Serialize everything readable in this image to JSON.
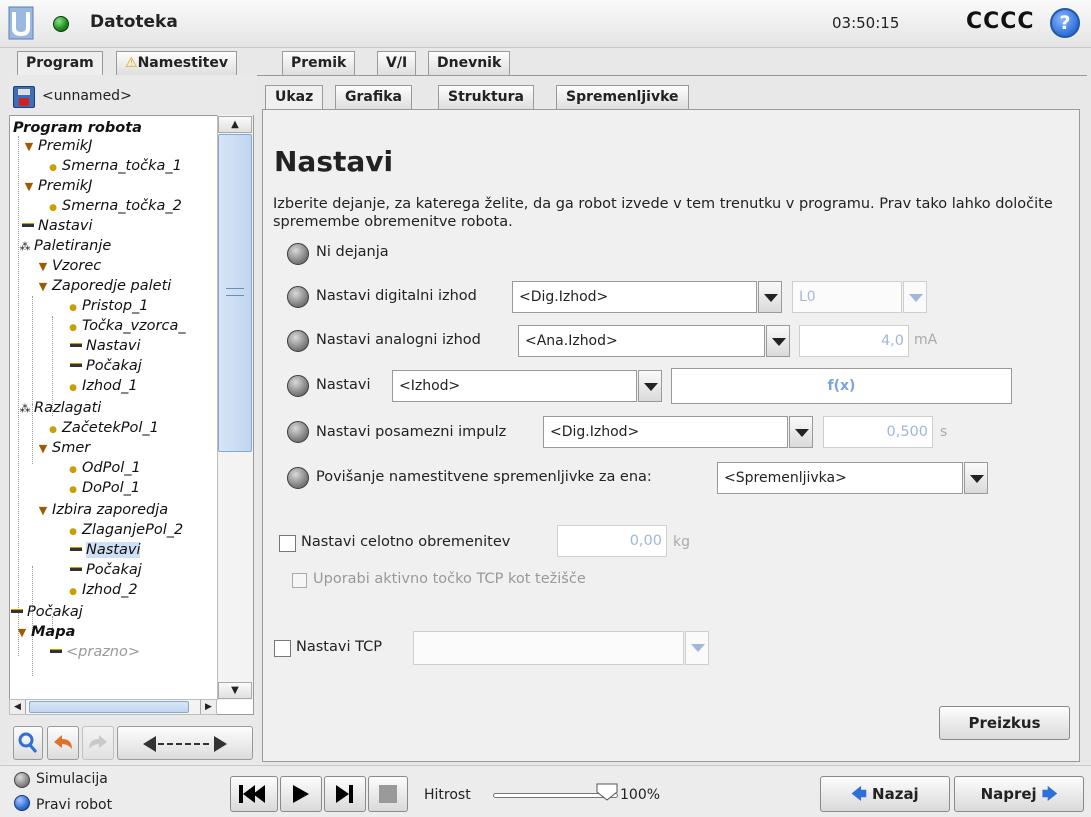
{
  "header": {
    "menu_label": "Datoteka",
    "clock": "03:50:15",
    "robot_name": "CCCC",
    "help": "?"
  },
  "main_tabs": [
    {
      "label": "Program",
      "active": true
    },
    {
      "label": "Namestitev",
      "warning": true
    },
    {
      "label": "Premik"
    },
    {
      "label": "V/I"
    },
    {
      "label": "Dnevnik"
    }
  ],
  "program": {
    "name": "<unnamed>",
    "tree": [
      {
        "label": "Program robota",
        "icon": "none",
        "bold": true
      },
      {
        "label": "PremikJ",
        "icon": "triangle-icon"
      },
      {
        "label": "Smerna_točka_1",
        "icon": "waypoint-icon"
      },
      {
        "label": "PremikJ",
        "icon": "triangle-icon"
      },
      {
        "label": "Smerna_točka_2",
        "icon": "waypoint-icon"
      },
      {
        "label": "Nastavi",
        "icon": "set-icon"
      },
      {
        "label": "Paletiranje",
        "icon": "pallet-icon"
      },
      {
        "label": "Vzorec",
        "icon": "triangle-icon"
      },
      {
        "label": "Zaporedje paleti",
        "icon": "triangle-icon"
      },
      {
        "label": "Pristop_1",
        "icon": "waypoint-icon"
      },
      {
        "label": "Točka_vzorca_",
        "icon": "waypoint-icon"
      },
      {
        "label": "Nastavi",
        "icon": "set-icon"
      },
      {
        "label": "Počakaj",
        "icon": "set-icon"
      },
      {
        "label": "Izhod_1",
        "icon": "waypoint-icon"
      },
      {
        "label": "Razlagati",
        "icon": "pallet-icon"
      },
      {
        "label": "ZačetekPol_1",
        "icon": "waypoint-icon"
      },
      {
        "label": "Smer",
        "icon": "triangle-icon"
      },
      {
        "label": "OdPol_1",
        "icon": "waypoint-icon"
      },
      {
        "label": "DoPol_1",
        "icon": "waypoint-icon"
      },
      {
        "label": "Izbira zaporedja",
        "icon": "triangle-icon"
      },
      {
        "label": "ZlaganjePol_2",
        "icon": "waypoint-icon"
      },
      {
        "label": "Nastavi",
        "icon": "set-icon",
        "selected": true
      },
      {
        "label": "Počakaj",
        "icon": "set-icon"
      },
      {
        "label": "Izhod_2",
        "icon": "waypoint-icon"
      },
      {
        "label": "Počakaj",
        "icon": "set-icon"
      },
      {
        "label": "Mapa",
        "icon": "triangle-icon",
        "bold": true
      },
      {
        "label": "<prazno>",
        "icon": "set-icon",
        "gray": true
      }
    ]
  },
  "sub_tabs": [
    {
      "label": "Ukaz",
      "active": true
    },
    {
      "label": "Grafika"
    },
    {
      "label": "Struktura"
    },
    {
      "label": "Spremenljivke"
    }
  ],
  "command": {
    "title": "Nastavi",
    "description": "Izberite dejanje, za katerega želite, da ga robot izvede v tem trenutku v programu. Prav tako lahko določite spremembe obremenitve robota.",
    "options": {
      "none": "Ni dejanja",
      "digital": "Nastavi digitalni izhod",
      "analog": "Nastavi analogni izhod",
      "set": "Nastavi",
      "pulse": "Nastavi posamezni impulz",
      "increment": "Povišanje namestitvene spremenljivke za ena:"
    },
    "digital_select": "<Dig.Izhod>",
    "digital_value": "L0",
    "analog_select": "<Ana.Izhod>",
    "analog_value": "4,0",
    "analog_unit": "mA",
    "set_select": "<Izhod>",
    "set_expression": "f(x)",
    "pulse_select": "<Dig.Izhod>",
    "pulse_value": "0,500",
    "pulse_unit": "s",
    "variable_select": "<Spremenljivka>",
    "payload_label": "Nastavi celotno obremenitev",
    "payload_value": "0,00",
    "payload_unit": "kg",
    "tcp_cog_label": "Uporabi aktivno točko TCP kot težišče",
    "tcp_label": "Nastavi TCP",
    "tcp_select": "",
    "test_button": "Preizkus"
  },
  "footer": {
    "simulation": "Simulacija",
    "real_robot": "Pravi robot",
    "speed_label": "Hitrost",
    "speed_value": "100%",
    "speed_fraction": 1.0,
    "back": "Nazaj",
    "next": "Naprej"
  }
}
